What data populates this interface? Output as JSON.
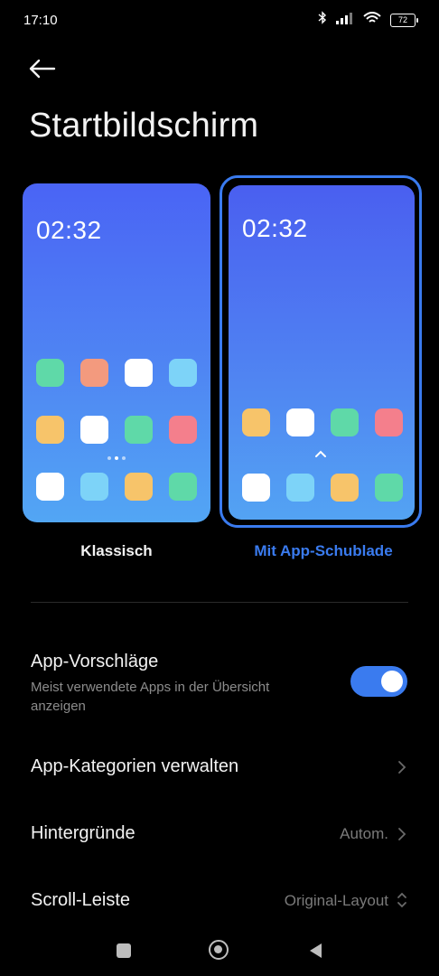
{
  "status": {
    "time": "17:10",
    "battery": "72"
  },
  "page": {
    "title": "Startbildschirm"
  },
  "styles": {
    "classic": {
      "label": "Klassisch",
      "clock": "02:32",
      "apps": [
        "#5fd9a8",
        "#f39a7e",
        "#ffffff",
        "#7dd3f8",
        "#f7c46a",
        "#ffffff",
        "#5fd9a8",
        "#f47f8c",
        "#ffffff",
        "#7dd3f8",
        "#f7c46a",
        "#5fd9a8"
      ]
    },
    "drawer": {
      "label": "Mit App-Schublade",
      "clock": "02:32",
      "selected": true,
      "apps": [
        "#f7c46a",
        "#ffffff",
        "#5fd9a8",
        "#f47f8c",
        "#ffffff",
        "#7dd3f8",
        "#f7c46a",
        "#5fd9a8"
      ]
    }
  },
  "settings": {
    "suggestions": {
      "title": "App-Vorschläge",
      "subtitle": "Meist verwendete Apps in der Übersicht anzeigen",
      "enabled": true
    },
    "categories": {
      "title": "App-Kategorien verwalten"
    },
    "backgrounds": {
      "title": "Hintergründe",
      "value": "Autom."
    },
    "scrollbar": {
      "title": "Scroll-Leiste",
      "value": "Original-Layout"
    }
  },
  "colors": {
    "accent": "#3a7bef",
    "background": "#000000"
  }
}
